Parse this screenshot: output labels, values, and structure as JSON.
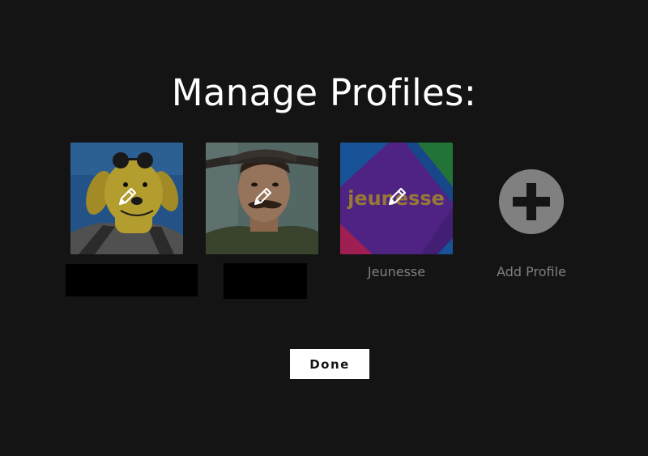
{
  "page": {
    "title": "Manage Profiles:"
  },
  "profiles": [
    {
      "name": "",
      "name_redacted": true,
      "avatar": "cartoon-dog-avatar",
      "action_icon": "pencil-icon"
    },
    {
      "name": "",
      "name_redacted": true,
      "avatar": "mustached-man-avatar",
      "action_icon": "pencil-icon"
    },
    {
      "name": "Jeunesse",
      "name_redacted": false,
      "avatar": "jeunesse-kids-avatar",
      "avatar_text": "jeunesse",
      "action_icon": "pencil-icon"
    }
  ],
  "add_profile": {
    "label": "Add Profile",
    "icon": "plus-circle-icon"
  },
  "done_button": {
    "label": "Done"
  },
  "colors": {
    "background": "#141414",
    "muted_text": "#808080",
    "button_bg": "#ffffff",
    "add_icon_bg": "#808080"
  }
}
